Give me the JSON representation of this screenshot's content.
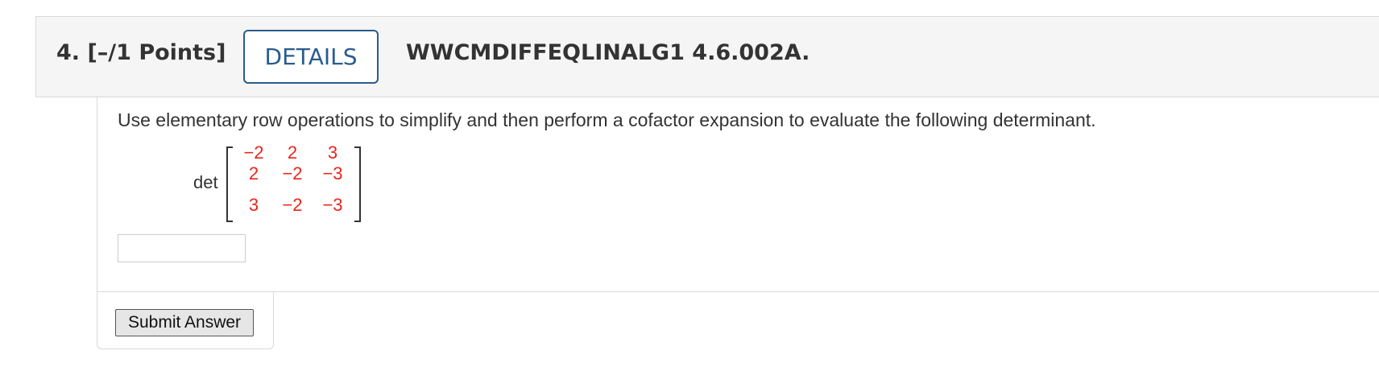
{
  "question": {
    "number_points": "4.  [–/1 Points]",
    "details_label": "DETAILS",
    "code": "WWCMDIFFEQLINALG1 4.6.002A."
  },
  "problem": {
    "instructions": "Use elementary row operations to simplify and then perform a cofactor expansion to evaluate the following determinant.",
    "det_label": "det",
    "matrix": [
      [
        "−2",
        "2",
        "3"
      ],
      [
        "2",
        "−2",
        "−3"
      ],
      [
        "3",
        "−2",
        "−3"
      ]
    ]
  },
  "answer": {
    "value": ""
  },
  "submit": {
    "label": "Submit Answer"
  },
  "colors": {
    "details_border": "#2a5c8c",
    "matrix_entries": "#e8261b",
    "header_bg": "#f5f5f5"
  }
}
